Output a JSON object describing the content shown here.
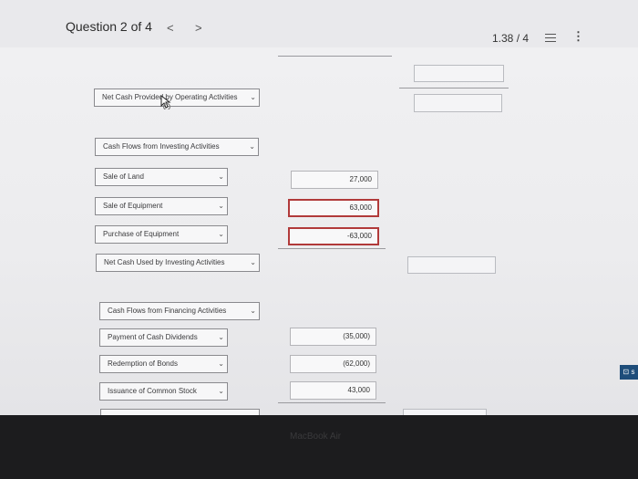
{
  "header": {
    "question": "Question 2 of 4",
    "prev": "<",
    "next": ">",
    "score": "1.38 / 4",
    "more": "⋮"
  },
  "operating": {
    "net_cash_label": "Net Cash Provided by Operating Activities"
  },
  "investing": {
    "section_label": "Cash Flows from Investing Activities",
    "rows": [
      {
        "label": "Sale of Land",
        "value": "27,000",
        "error": false
      },
      {
        "label": "Sale of Equipment",
        "value": "63,000",
        "error": true
      },
      {
        "label": "Purchase of Equipment",
        "value": "-63,000",
        "error": true
      }
    ],
    "net_label": "Net Cash Used by Investing Activities"
  },
  "financing": {
    "section_label": "Cash Flows from Financing Activities",
    "rows": [
      {
        "label": "Payment of Cash Dividends",
        "value": "(35,000)"
      },
      {
        "label": "Redemption of Bonds",
        "value": "(62,000)"
      },
      {
        "label": "Issuance of Common Stock",
        "value": "43,000"
      }
    ]
  },
  "chat_badge": "⊡ s",
  "bezel": "MacBook Air",
  "icons": [
    "chevron-left-icon",
    "chevron-right-icon",
    "list-icon",
    "more-icon",
    "chevron-down-icon",
    "cursor-icon",
    "chat-icon"
  ]
}
